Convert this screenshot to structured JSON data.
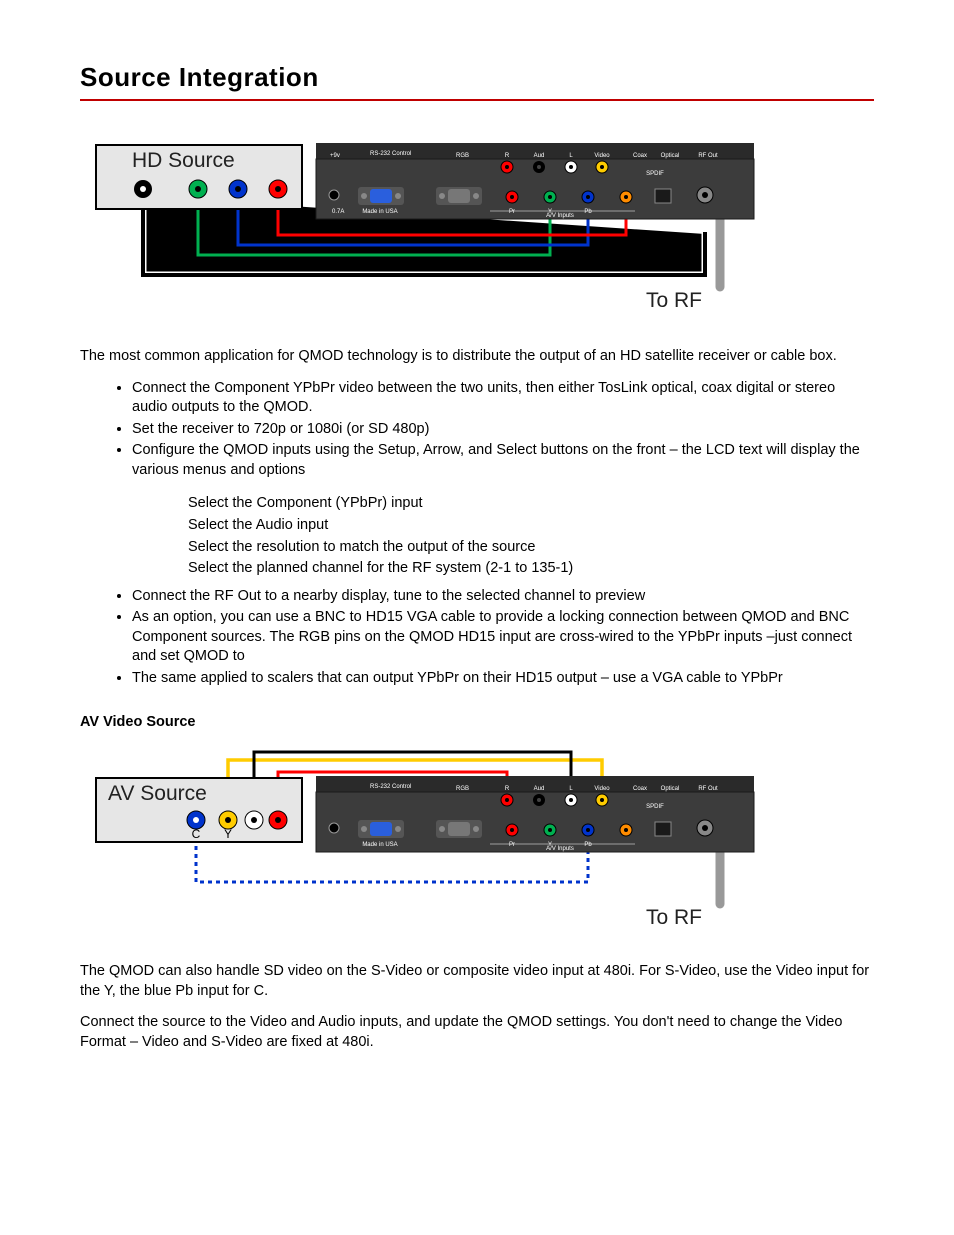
{
  "title": "Source Integration",
  "figure1": {
    "source_label": "HD Source",
    "to_rf": "To RF",
    "dev": {
      "r": "R",
      "aud": "Aud",
      "l": "L",
      "video": "Video",
      "coax": "Coax",
      "optical": "Optical",
      "rfout": "RF Out",
      "spdif": "SPDIF",
      "rs232": "RS-232\nControl",
      "rgb": "RGB",
      "avinputs": "A/V Inputs",
      "made": "Made in USA",
      "y": "Y",
      "pb": "Pb",
      "pr": "Pr"
    }
  },
  "p1": "The most common application for QMOD technology is to distribute the output of an HD satellite receiver or cable box.",
  "bullets": [
    "Connect the Component YPbPr video between the two units, then either TosLink optical, coax digital or stereo audio outputs to the QMOD.",
    "Set the receiver to 720p or 1080i (or SD 480p)",
    "Configure the QMOD inputs using the Setup, Arrow, and Select buttons on the front – the LCD text will display the various menus and options"
  ],
  "subitems": [
    "Select the Component (YPbPr) input",
    "Select the Audio input",
    "Select the resolution to match the output of the source",
    "Select the planned channel for the RF system (2-1 to 135-1)"
  ],
  "bullets2": [
    "Connect the RF Out to a nearby display, tune to the selected channel to preview",
    "As an option, you can use a BNC to HD15 VGA cable to provide a locking connection between QMOD and BNC Component sources. The RGB pins on the QMOD HD15 input are cross-wired to the YPbPr inputs –just connect and set QMOD to",
    "The same applied to scalers that can output YPbPr on their HD15 output – use a VGA cable to YPbPr"
  ],
  "subhead": "AV Video Source",
  "figure2": {
    "source_label": "AV Source",
    "c": "C",
    "y": "Y",
    "to_rf": "To RF"
  },
  "p2": "The QMOD can also handle SD video on the S-Video or composite video input at 480i. For S-Video, use the Video input for the Y, the blue Pb input for C.",
  "p3": "Connect the source to the Video and Audio inputs, and update the QMOD settings. You don't need to change the Video Format – Video and S-Video are fixed at 480i."
}
